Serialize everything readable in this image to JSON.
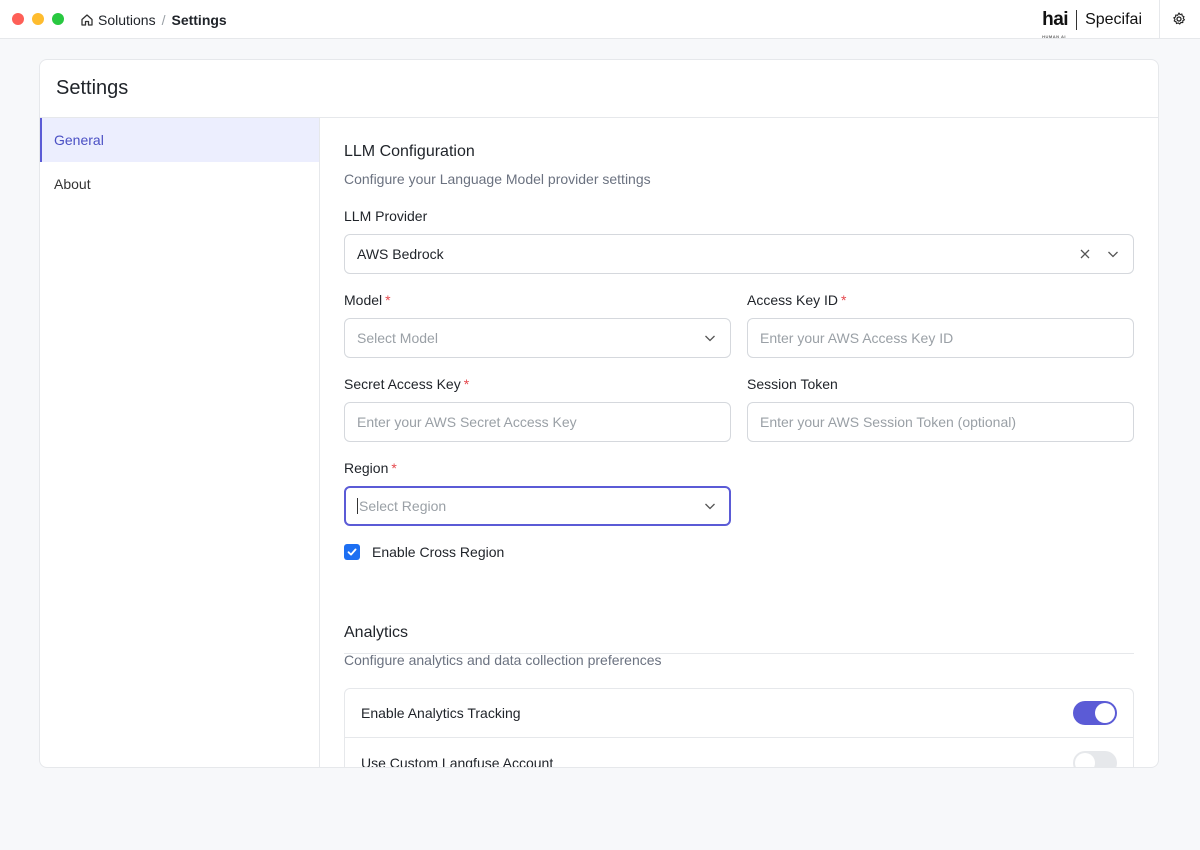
{
  "titlebar": {
    "breadcrumb": {
      "root": "Solutions",
      "separator": "/",
      "current": "Settings"
    },
    "brand": {
      "logo": "hai",
      "logo_sub": "HUMAN AI",
      "name": "Specifai"
    }
  },
  "page": {
    "title": "Settings"
  },
  "sidebar": {
    "items": [
      {
        "label": "General",
        "active": true
      },
      {
        "label": "About",
        "active": false
      }
    ]
  },
  "llm": {
    "title": "LLM Configuration",
    "description": "Configure your Language Model provider settings",
    "provider": {
      "label": "LLM Provider",
      "value": "AWS Bedrock"
    },
    "model": {
      "label": "Model",
      "required": "*",
      "placeholder": "Select Model"
    },
    "access_key_id": {
      "label": "Access Key ID",
      "required": "*",
      "placeholder": "Enter your AWS Access Key ID"
    },
    "secret_access_key": {
      "label": "Secret Access Key",
      "required": "*",
      "placeholder": "Enter your AWS Secret Access Key"
    },
    "session_token": {
      "label": "Session Token",
      "placeholder": "Enter your AWS Session Token (optional)"
    },
    "region": {
      "label": "Region",
      "required": "*",
      "placeholder": "Select Region"
    },
    "cross_region": {
      "label": "Enable Cross Region",
      "checked": true
    }
  },
  "analytics": {
    "title": "Analytics",
    "description": "Configure analytics and data collection preferences",
    "toggles": [
      {
        "label": "Enable Analytics Tracking",
        "on": true
      },
      {
        "label": "Use Custom Langfuse Account",
        "on": false
      }
    ]
  },
  "colors": {
    "accent": "#5b5bd6",
    "checkbox": "#1d6ff2",
    "required": "#e5484d"
  }
}
